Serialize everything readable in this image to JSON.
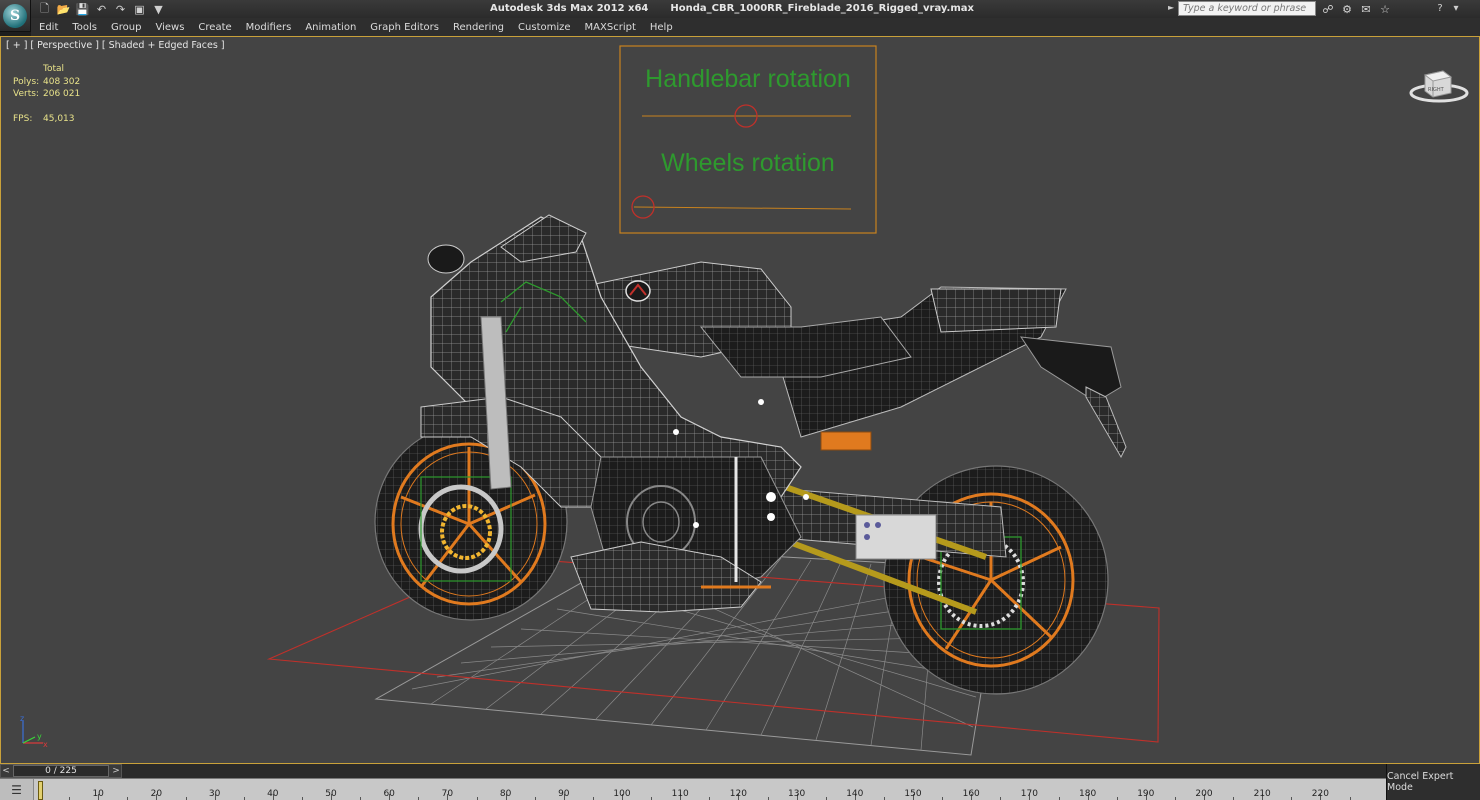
{
  "app": {
    "logo_letter": "S",
    "title": "Autodesk 3ds Max  2012 x64",
    "filename": "Honda_CBR_1000RR_Fireblade_2016_Rigged_vray.max"
  },
  "quick_access": [
    "new-file-icon",
    "open-file-icon",
    "save-icon",
    "undo-icon",
    "redo-icon",
    "project-folder-icon",
    "dropdown-icon"
  ],
  "search": {
    "placeholder": "Type a keyword or phrase"
  },
  "menu": [
    "Edit",
    "Tools",
    "Group",
    "Views",
    "Create",
    "Modifiers",
    "Animation",
    "Graph Editors",
    "Rendering",
    "Customize",
    "MAXScript",
    "Help"
  ],
  "viewport": {
    "label": "[ + ] [ Perspective ] [ Shaded + Edged Faces ]",
    "stats": {
      "header": "Total",
      "polys_label": "Polys:",
      "polys": "408 302",
      "verts_label": "Verts:",
      "verts": "206 021",
      "fps_label": "FPS:",
      "fps": "45,013"
    },
    "rig_panel": {
      "handlebar_label": "Handlebar rotation",
      "wheels_label": "Wheels rotation"
    },
    "viewcube_label": "RIGHT",
    "axis": {
      "x": "x",
      "y": "y",
      "z": "z"
    }
  },
  "time_slider": {
    "prev": "<",
    "next": ">",
    "readout": "0 / 225"
  },
  "timeline": {
    "ticks": [
      "10",
      "20",
      "30",
      "40",
      "50",
      "60",
      "70",
      "80",
      "90",
      "100",
      "110",
      "120",
      "130",
      "140",
      "150",
      "160",
      "170",
      "180",
      "190",
      "200",
      "210",
      "220"
    ]
  },
  "expert_mode": {
    "label": "Cancel Expert Mode"
  },
  "colors": {
    "viewport_bg": "#444444",
    "wire_grey": "#c8c8c8",
    "wire_orange": "#e07a1f",
    "rig_green": "#2e9a2e",
    "rig_box": "#c8821e",
    "selection_red": "#c0302a",
    "stats_yellow": "#e8e28a"
  }
}
